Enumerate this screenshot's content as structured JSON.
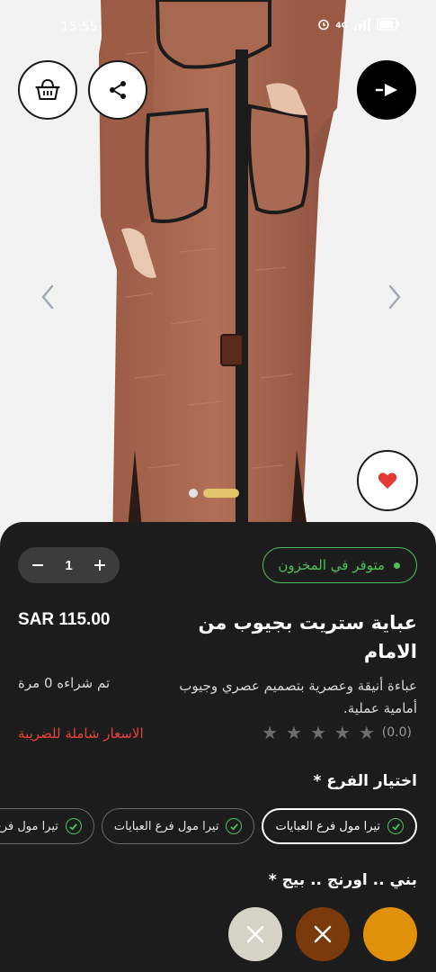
{
  "status_bar": {
    "time": "15:55",
    "network": "4G"
  },
  "hero": {
    "carousel": {
      "count": 2,
      "active_index": 1
    }
  },
  "product": {
    "quantity": "1",
    "stock_label": "متوفر في المخزون",
    "price": "SAR 115.00",
    "title": "عباية ستريت بجيوب من الامام",
    "purchased_label": "تم شراءه 0 مرة",
    "description": "عباءة أنيقة وعصرية بتصميم عصري وجيوب أمامية عملية.",
    "tax_note": "الاسعار شاملة للضريبة",
    "rating_text": "(0.0)",
    "rating_value": 0,
    "rating_max": 5
  },
  "branch": {
    "heading": "اختيار الفرع *",
    "options": [
      {
        "label": "تيرا مول فرع العبايات",
        "selected": true
      },
      {
        "label": "تيرا مول فرع العبايات",
        "selected": false
      },
      {
        "label": "تيرا مول فرع العبايات",
        "selected": false
      }
    ]
  },
  "colors": {
    "heading": "بني .. اورنج .. بيج *",
    "swatches": [
      {
        "name": "orange",
        "hex": "#e0900a",
        "available": true
      },
      {
        "name": "brown",
        "hex": "#7a3a0c",
        "available": false
      },
      {
        "name": "beige",
        "hex": "#d6d4c6",
        "available": false
      }
    ]
  },
  "theme": {
    "accent_green": "#4cc15a",
    "tax_red": "#e2443c",
    "favorite_red": "#e53935",
    "sheet_bg": "#1c1c1c"
  }
}
